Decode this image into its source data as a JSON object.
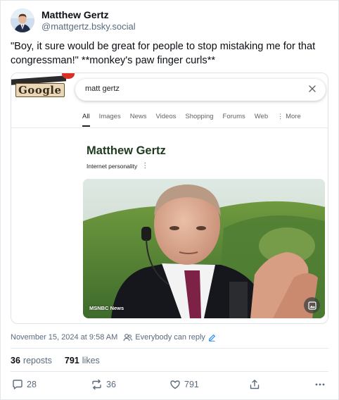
{
  "post": {
    "author_name": "Matthew Gertz",
    "author_handle": "@mattgertz.bsky.social",
    "text": "\"Boy, it sure would be great for people to stop mistaking me for that congressman!\" **monkey's paw finger curls**",
    "timestamp": "November 15, 2024 at 9:58 AM",
    "reply_setting": "Everybody can reply"
  },
  "embed": {
    "logo_text": "Google",
    "search_query": "matt gertz",
    "tabs": [
      "All",
      "Images",
      "News",
      "Videos",
      "Shopping",
      "Forums",
      "Web",
      "More"
    ],
    "knowledge_title": "Matthew Gertz",
    "knowledge_subtitle": "Internet personality",
    "photo_credit": "MSNBC News"
  },
  "stats": {
    "reposts_count": "36",
    "reposts_label": "reposts",
    "likes_count": "791",
    "likes_label": "likes"
  },
  "actions": {
    "reply_count": "28",
    "repost_count": "36",
    "like_count": "791"
  },
  "icons": {
    "reply": "comment-icon",
    "repost": "repost-icon",
    "like": "heart-icon",
    "share": "share-icon",
    "more": "more-icon",
    "people": "people-icon",
    "edit": "pencil-icon",
    "close": "close-icon",
    "image": "image-icon"
  },
  "colors": {
    "text_primary": "#0b0f14",
    "text_secondary": "#5b6b7c",
    "accent": "#1083fe",
    "knowledge_title": "#1e3a1e"
  }
}
